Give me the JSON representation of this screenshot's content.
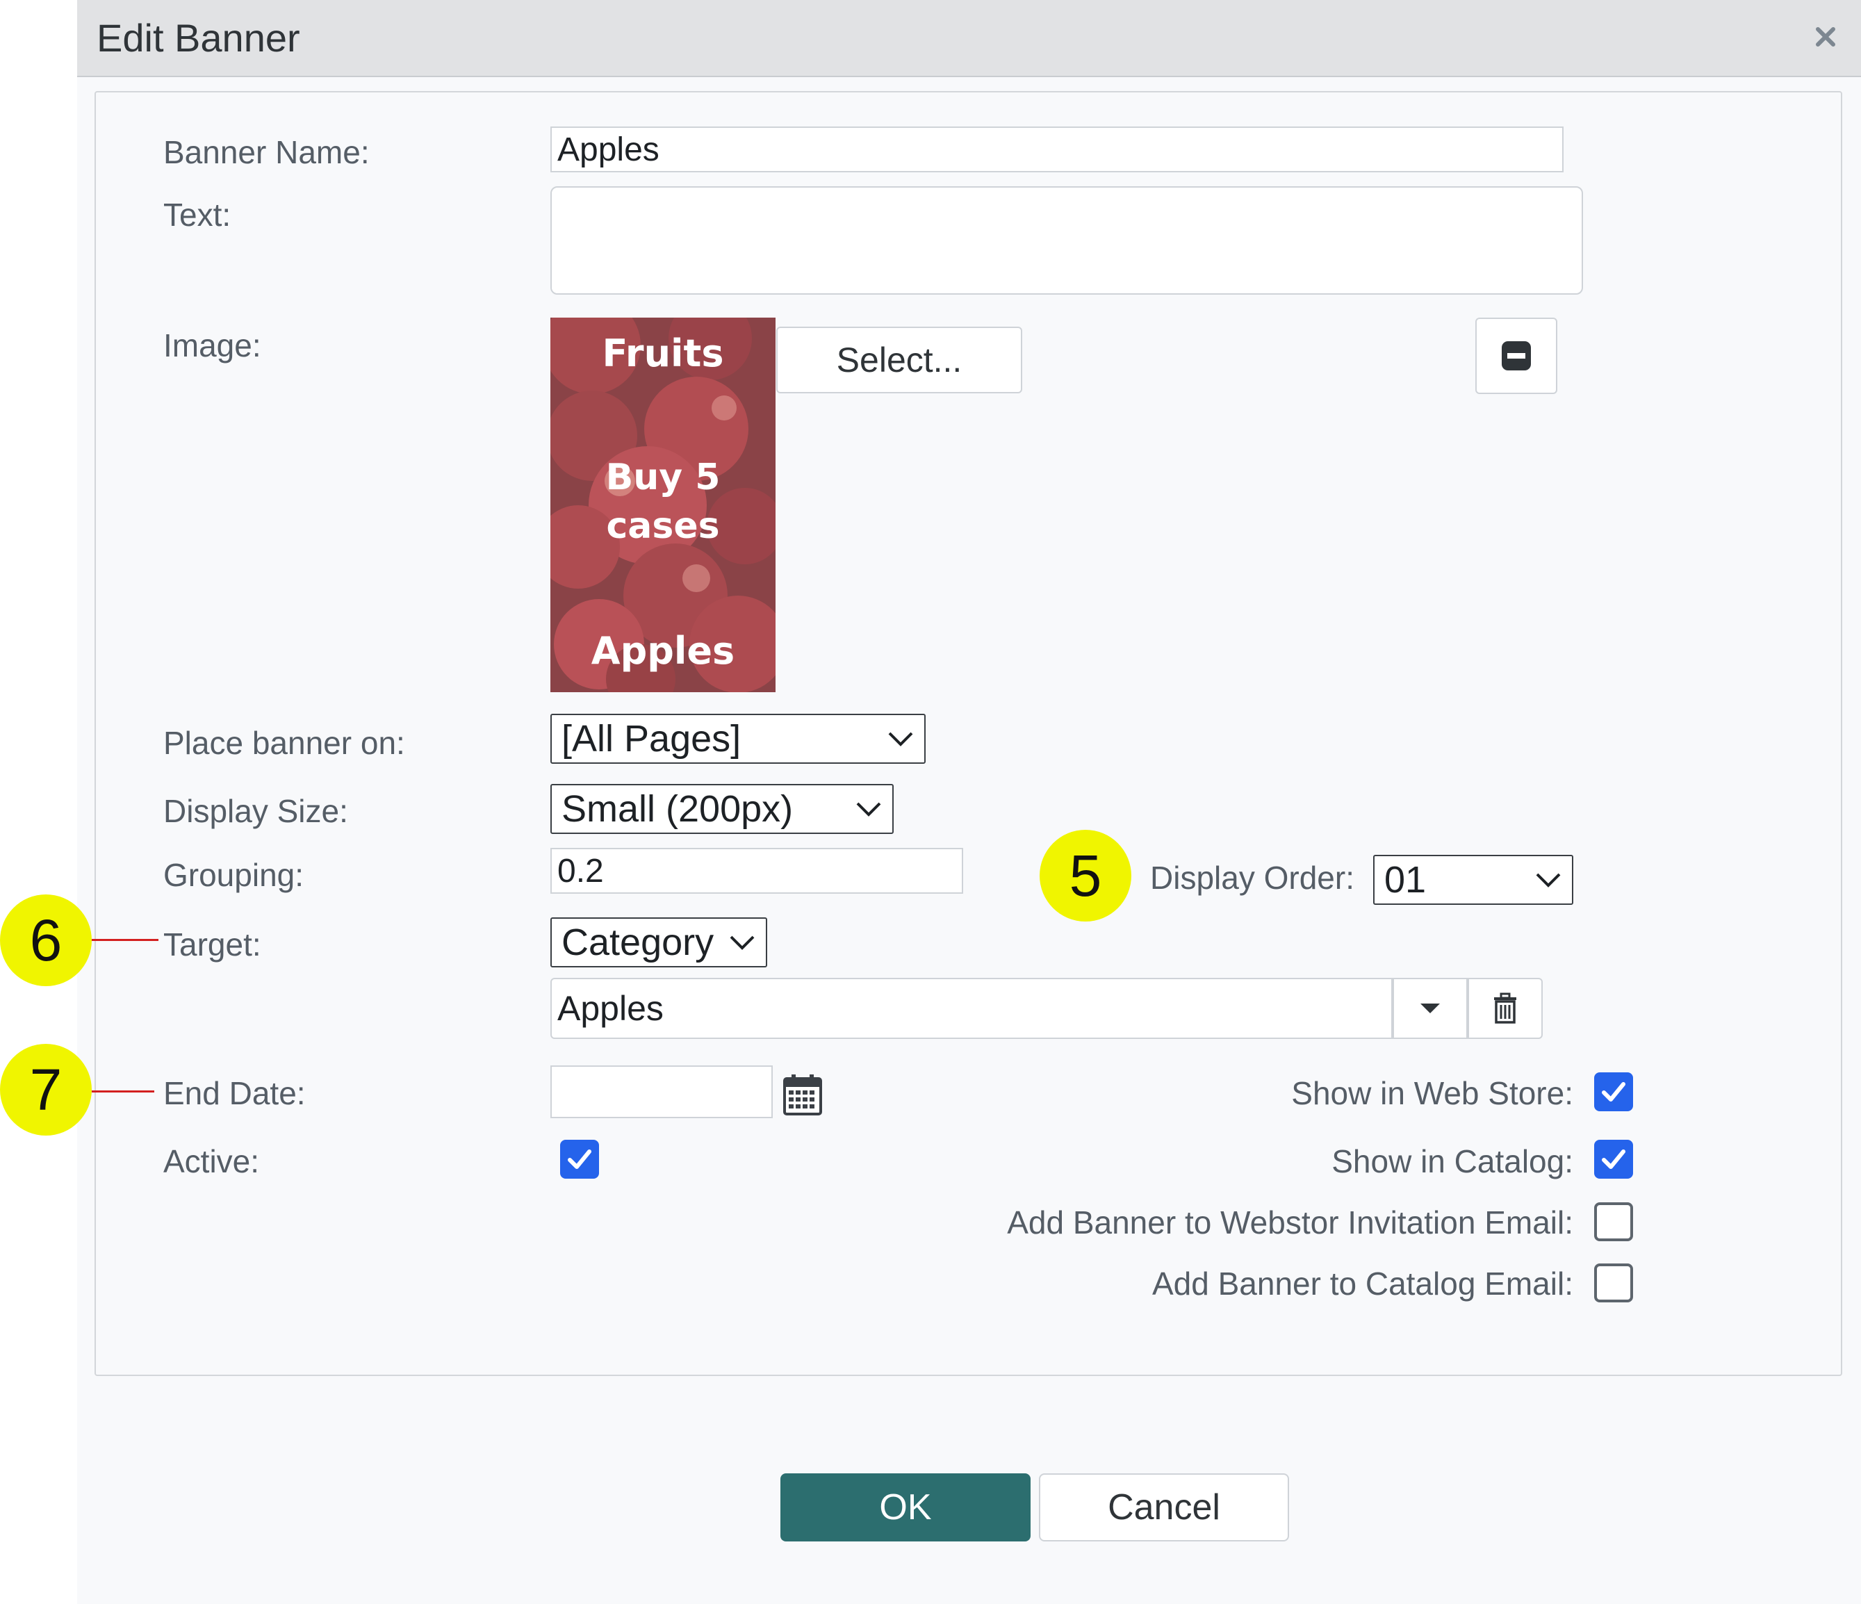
{
  "dialog": {
    "title": "Edit Banner",
    "close_icon": "close-icon"
  },
  "form": {
    "banner_name_label": "Banner Name:",
    "banner_name_value": "Apples",
    "text_label": "Text:",
    "text_value": "",
    "image_label": "Image:",
    "select_button": "Select...",
    "image_text": {
      "line1": "Fruits",
      "line2": "Buy 5",
      "line3": "cases",
      "line4": "Apples"
    },
    "place_label": "Place banner on:",
    "place_value": "[All Pages]",
    "display_size_label": "Display Size:",
    "display_size_value": "Small (200px)",
    "grouping_label": "Grouping:",
    "grouping_value": "0.2",
    "display_order_label": "Display Order:",
    "display_order_value": "01",
    "target_label": "Target:",
    "target_value": "Category",
    "target_item_value": "Apples",
    "end_date_label": "End Date:",
    "end_date_value": "",
    "active_label": "Active:",
    "active_checked": true,
    "show_web_store_label": "Show in Web Store:",
    "show_web_store_checked": true,
    "show_catalog_label": "Show in Catalog:",
    "show_catalog_checked": true,
    "add_webstore_email_label": "Add Banner to Webstor Invitation Email:",
    "add_webstore_email_checked": false,
    "add_catalog_email_label": "Add Banner to Catalog Email:",
    "add_catalog_email_checked": false
  },
  "buttons": {
    "ok": "OK",
    "cancel": "Cancel"
  },
  "callouts": {
    "five": "5",
    "six": "6",
    "seven": "7"
  },
  "colors": {
    "accent": "#2c6e6f",
    "checkbox": "#2563eb",
    "callout": "#f0f500",
    "leader": "#d32020"
  }
}
